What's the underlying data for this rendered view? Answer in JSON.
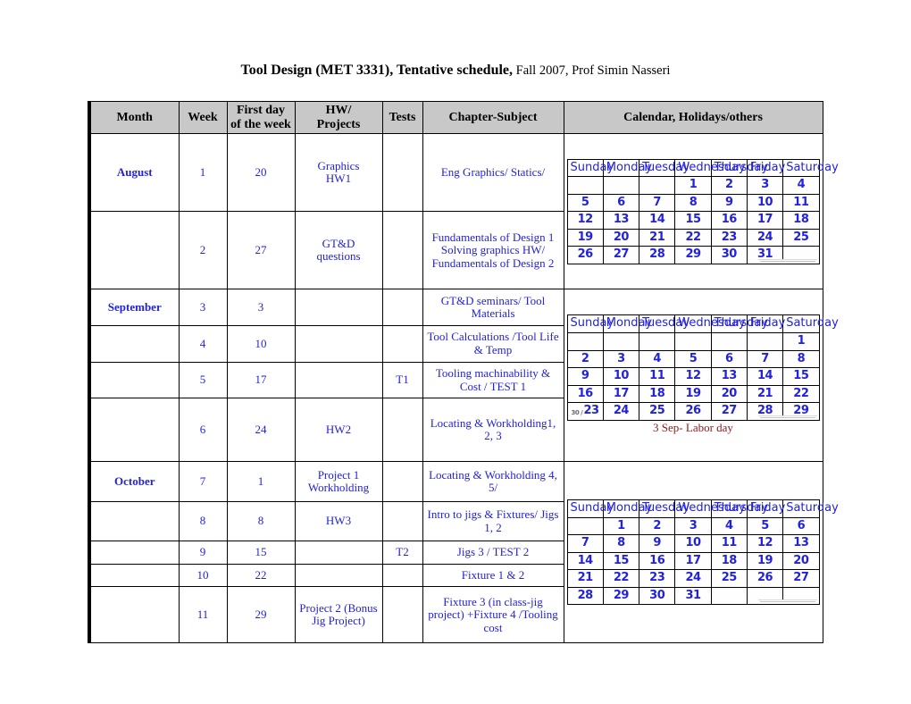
{
  "title": {
    "strong": "Tool Design (MET 3331), Tentative schedule,",
    "light": " Fall 2007, Prof Simin Nasseri"
  },
  "colors": {
    "header_bg": "#c8c8c8",
    "month_text": "#8b1a1a",
    "body_text": "#2222dd",
    "note_text": "#8b1a1a",
    "border": "#000000"
  },
  "table": {
    "headers": {
      "month": "Month",
      "week": "Week",
      "first_day_line1": "First day",
      "first_day_line2": "of the week",
      "hw_line1": "HW/",
      "hw_line2": "Projects",
      "tests": "Tests",
      "chapter": "Chapter-Subject",
      "calendar": "Calendar, Holidays/others"
    },
    "rows": [
      {
        "month": "August",
        "week": "1",
        "first_day": "20",
        "hw": "Graphics\nHW1",
        "tests": "",
        "chapter": "Eng Graphics/ Statics/",
        "chapter_align": "center"
      },
      {
        "month": "",
        "week": "2",
        "first_day": "27",
        "hw": "GT&D\nquestions",
        "tests": "",
        "chapter": "Fundamentals of Design 1\nSolving graphics HW/ Fundamentals of Design 2",
        "chapter_align": "left"
      },
      {
        "month": "September",
        "week": "3",
        "first_day": "3",
        "hw": "",
        "tests": "",
        "chapter": "GT&D seminars/ Tool Materials",
        "chapter_align": "center"
      },
      {
        "month": "",
        "week": "4",
        "first_day": "10",
        "hw": "",
        "tests": "",
        "chapter": "Tool Calculations /Tool Life & Temp",
        "chapter_align": "center"
      },
      {
        "month": "",
        "week": "5",
        "first_day": "17",
        "hw": "",
        "tests": "T1",
        "chapter": "Tooling machinability & Cost / TEST 1",
        "chapter_align": "center"
      },
      {
        "month": "",
        "week": "6",
        "first_day": "24",
        "hw": "HW2",
        "tests": "",
        "chapter": "Locating & Workholding1, 2, 3",
        "chapter_align": "center"
      },
      {
        "month": "October",
        "week": "7",
        "first_day": "1",
        "hw": "Project 1 Workholding",
        "tests": "",
        "chapter": "Locating & Workholding 4, 5/",
        "chapter_align": "center"
      },
      {
        "month": "",
        "week": "8",
        "first_day": "8",
        "hw": "HW3",
        "tests": "",
        "chapter": "Intro to jigs & Fixtures/ Jigs 1, 2",
        "chapter_align": "center"
      },
      {
        "month": "",
        "week": "9",
        "first_day": "15",
        "hw": "",
        "tests": "T2",
        "chapter": "Jigs 3 / TEST 2",
        "chapter_align": "center"
      },
      {
        "month": "",
        "week": "10",
        "first_day": "22",
        "hw": "",
        "tests": "",
        "chapter": "Fixture 1 & 2",
        "chapter_align": "center"
      },
      {
        "month": "",
        "week": "11",
        "first_day": "29",
        "hw": "Project 2 (Bonus Jig Project)",
        "tests": "",
        "chapter": "Fixture 3 (in class-jig project) +Fixture 4 /Tooling cost",
        "chapter_align": "center"
      }
    ]
  },
  "calendars": [
    {
      "name": "august-calendar",
      "daynames": [
        "Sunday",
        "Monday",
        "Tuesday",
        "Wednesday",
        "Thursday",
        "Friday",
        "Saturday"
      ],
      "weeks": [
        [
          "",
          "",
          "",
          "1",
          "2",
          "3",
          "4"
        ],
        [
          "5",
          "6",
          "7",
          "8",
          "9",
          "10",
          "11"
        ],
        [
          "12",
          "13",
          "14",
          "15",
          "16",
          "17",
          "18"
        ],
        [
          "19",
          "20",
          "21",
          "22",
          "23",
          "24",
          "25"
        ],
        [
          "26",
          "27",
          "28",
          "29",
          "30",
          "31",
          ""
        ]
      ],
      "prefixes": {},
      "note": ""
    },
    {
      "name": "september-calendar",
      "daynames": [
        "Sunday",
        "Monday",
        "Tuesday",
        "Wednesday",
        "Thursday",
        "Friday",
        "Saturday"
      ],
      "weeks": [
        [
          "",
          "",
          "",
          "",
          "",
          "",
          "1"
        ],
        [
          "2",
          "3",
          "4",
          "5",
          "6",
          "7",
          "8"
        ],
        [
          "9",
          "10",
          "11",
          "12",
          "13",
          "14",
          "15"
        ],
        [
          "16",
          "17",
          "18",
          "19",
          "20",
          "21",
          "22"
        ],
        [
          "23",
          "24",
          "25",
          "26",
          "27",
          "28",
          "29"
        ]
      ],
      "prefixes": {
        "4-0": "30 /"
      },
      "note": "3 Sep- Labor day"
    },
    {
      "name": "october-calendar",
      "daynames": [
        "Sunday",
        "Monday",
        "Tuesday",
        "Wednesday",
        "Thursday",
        "Friday",
        "Saturday"
      ],
      "weeks": [
        [
          "",
          "1",
          "2",
          "3",
          "4",
          "5",
          "6"
        ],
        [
          "7",
          "8",
          "9",
          "10",
          "11",
          "12",
          "13"
        ],
        [
          "14",
          "15",
          "16",
          "17",
          "18",
          "19",
          "20"
        ],
        [
          "21",
          "22",
          "23",
          "24",
          "25",
          "26",
          "27"
        ],
        [
          "28",
          "29",
          "30",
          "31",
          "",
          "",
          ""
        ]
      ],
      "prefixes": {},
      "note": ""
    }
  ]
}
